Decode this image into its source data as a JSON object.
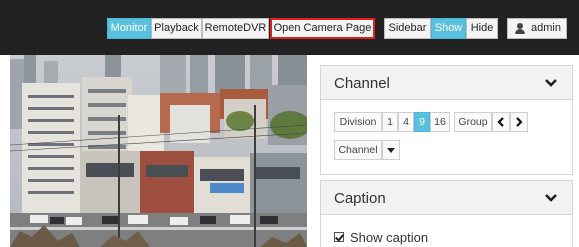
{
  "topbar": {
    "monitor": "Monitor",
    "playback": "Playback",
    "remotedvr": "RemoteDVR",
    "open_camera_page": "Open Camera Page",
    "sidebar": "Sidebar",
    "show": "Show",
    "hide": "Hide",
    "user": "admin"
  },
  "channel_panel": {
    "title": "Channel",
    "division_label": "Division",
    "divisions": [
      "1",
      "4",
      "9",
      "16"
    ],
    "active_division": "9",
    "group_label": "Group",
    "channel_label": "Channel"
  },
  "caption_panel": {
    "title": "Caption",
    "show_caption": "Show caption",
    "show_caption_checked": true
  },
  "colors": {
    "accent": "#5bc0de",
    "topbar": "#222222",
    "highlight": "#e0201b"
  },
  "icons": {
    "user": "user-icon",
    "collapse": "chevron-down-icon",
    "prev": "chevron-left-icon",
    "next": "chevron-right-icon",
    "dropdown": "caret-down-icon"
  }
}
